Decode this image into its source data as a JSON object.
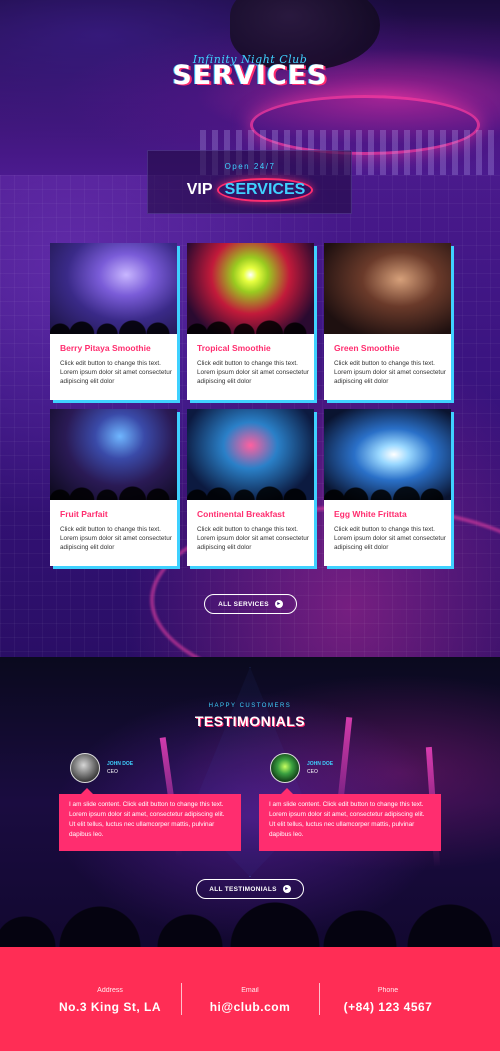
{
  "hero": {
    "script_title": "Infinity Night Club",
    "title": "SERVICES"
  },
  "vip": {
    "open": "Open 24/7",
    "title_prefix": "VIP",
    "title_highlight": "SERVICES"
  },
  "cards": [
    {
      "title": "Berry Pitaya Smoothie",
      "text": "Click edit button to change this text. Lorem ipsum dolor sit amet consectetur adipiscing elit dolor"
    },
    {
      "title": "Tropical Smoothie",
      "text": "Click edit button to change this text. Lorem ipsum dolor sit amet consectetur adipiscing elit dolor"
    },
    {
      "title": "Green Smoothie",
      "text": "Click edit button to change this text. Lorem ipsum dolor sit amet consectetur adipiscing elit dolor"
    },
    {
      "title": "Fruit Parfait",
      "text": "Click edit button to change this text. Lorem ipsum dolor sit amet consectetur adipiscing elit dolor"
    },
    {
      "title": "Continental Breakfast",
      "text": "Click edit button to change this text. Lorem ipsum dolor sit amet consectetur adipiscing elit dolor"
    },
    {
      "title": "Egg White Frittata",
      "text": "Click edit button to change this text. Lorem ipsum dolor sit amet consectetur adipiscing elit dolor"
    }
  ],
  "all_services_button": "ALL SERVICES",
  "testimonials": {
    "subtitle": "HAPPY CUSTOMERS",
    "title": "TESTIMONIALS",
    "items": [
      {
        "name": "JOHN DOE",
        "role": "CEO",
        "text": "I am slide content. Click edit button to change this text. Lorem ipsum dolor sit amet, consectetur adipiscing elit. Ut elit tellus, luctus nec ullamcorper mattis, pulvinar dapibus leo."
      },
      {
        "name": "JOHN DOE",
        "role": "CEO",
        "text": "I am slide content. Click edit button to change this text. Lorem ipsum dolor sit amet, consectetur adipiscing elit. Ut elit tellus, luctus nec ullamcorper mattis, pulvinar dapibus leo."
      }
    ],
    "button": "ALL TESTIMONIALS"
  },
  "footer": {
    "address_label": "Address",
    "address_value": "No.3 King St, LA",
    "email_label": "Email",
    "email_value": "hi@club.com",
    "phone_label": "Phone",
    "phone_value": "(+84) 123 4567"
  },
  "colors": {
    "accent_pink": "#ff2d6f",
    "accent_cyan": "#3fd1ff",
    "footer_bg": "#ff2d55",
    "section_purple": "#3a1480"
  },
  "icons": {
    "button_arrow": "arrow-right-circle-icon"
  }
}
